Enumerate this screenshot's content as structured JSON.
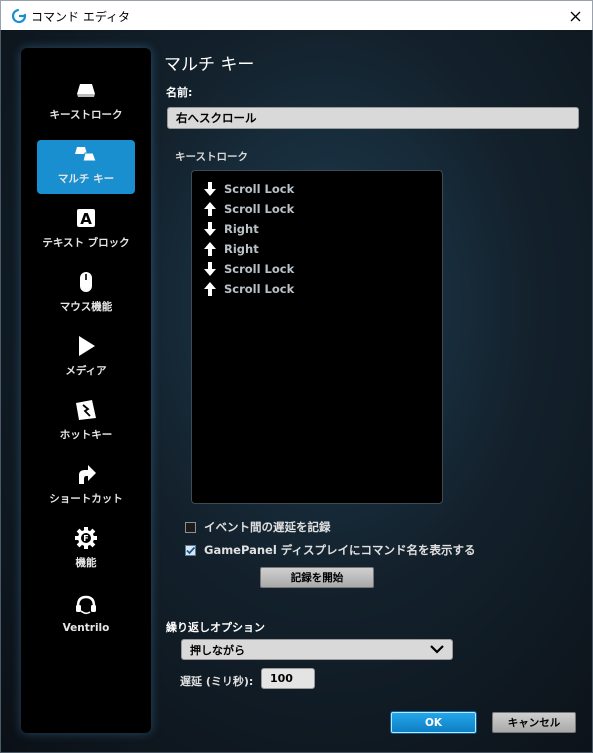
{
  "window": {
    "title": "コマンド エディタ",
    "close_icon": "close-icon"
  },
  "sidebar": {
    "items": [
      {
        "label": "キーストローク",
        "icon": "key-icon"
      },
      {
        "label": "マルチ キー",
        "icon": "multi-key-icon",
        "active": true
      },
      {
        "label": "テキスト ブロック",
        "icon": "text-block-icon"
      },
      {
        "label": "マウス機能",
        "icon": "mouse-icon"
      },
      {
        "label": "メディア",
        "icon": "play-icon"
      },
      {
        "label": "ホットキー",
        "icon": "hotkey-icon"
      },
      {
        "label": "ショートカット",
        "icon": "shortcut-arrow-icon"
      },
      {
        "label": "機能",
        "icon": "function-gear-icon"
      },
      {
        "label": "Ventrilo",
        "icon": "headset-icon"
      }
    ]
  },
  "main": {
    "title": "マルチ キー",
    "name_label": "名前:",
    "name_value": "右へスクロール",
    "keystroke_label": "キーストローク",
    "keystrokes": [
      {
        "dir": "down",
        "key": "Scroll Lock"
      },
      {
        "dir": "up",
        "key": "Scroll Lock"
      },
      {
        "dir": "down",
        "key": "Right"
      },
      {
        "dir": "up",
        "key": "Right"
      },
      {
        "dir": "down",
        "key": "Scroll Lock"
      },
      {
        "dir": "up",
        "key": "Scroll Lock"
      }
    ],
    "record_delay_label": "イベント間の遅延を記録",
    "record_delay_checked": false,
    "show_name_label": "GamePanel ディスプレイにコマンド名を表示する",
    "show_name_checked": true,
    "start_record_label": "記録を開始",
    "repeat_label": "繰り返しオプション",
    "repeat_value": "押しながら",
    "delay_label": "遅延 (ミリ秒):",
    "delay_value": "100"
  },
  "footer": {
    "ok_label": "OK",
    "cancel_label": "キャンセル"
  },
  "colors": {
    "accent": "#1a8fd0",
    "background": "#13212c",
    "panel": "#000000"
  }
}
